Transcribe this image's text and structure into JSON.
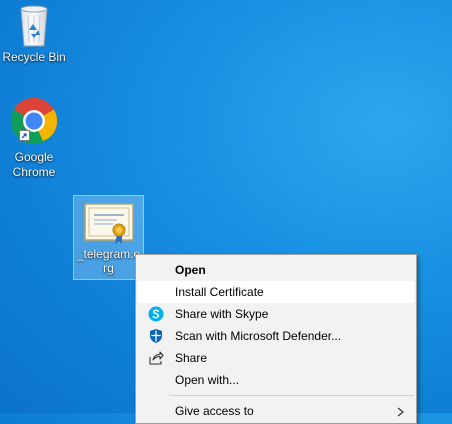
{
  "desktop": {
    "icons": [
      {
        "label": "Recycle Bin",
        "icon": "recycle-bin-icon"
      },
      {
        "label": "Google Chrome",
        "icon": "chrome-icon"
      },
      {
        "label": "_telegram.org",
        "icon": "certificate-icon"
      }
    ]
  },
  "context_menu": {
    "items": [
      {
        "label": "Open",
        "default": true
      },
      {
        "label": "Install Certificate"
      },
      {
        "label": "Share with Skype",
        "icon": "skype-icon"
      },
      {
        "label": "Scan with Microsoft Defender...",
        "icon": "defender-icon"
      },
      {
        "label": "Share",
        "icon": "share-icon"
      },
      {
        "label": "Open with..."
      },
      {
        "label": "Give access to",
        "submenu": true
      }
    ]
  },
  "colors": {
    "desktop_background": "#1589de",
    "menu_background": "#f2f2f2",
    "menu_hover": "#ffffff",
    "skype_blue": "#00aff0",
    "defender_blue": "#0a64b4"
  }
}
